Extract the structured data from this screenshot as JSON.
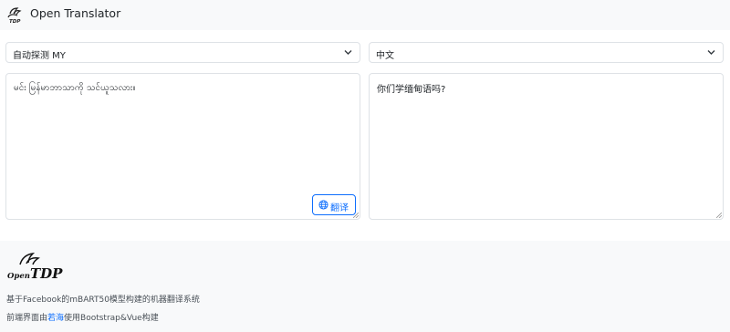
{
  "header": {
    "title": "Open Translator",
    "logo_icon": "tdp-bird-logo-icon"
  },
  "source": {
    "language": "自动探测 MY",
    "text": "မင်း မြန်မာဘာသာကို သင်ယူသလား။"
  },
  "target": {
    "language": "中文",
    "text": "你们学缅甸语吗?"
  },
  "translate_button": {
    "label": "翻译",
    "icon": "globe-icon"
  },
  "footer": {
    "logo_open": "Open",
    "logo_tdp": "TDP",
    "line1": "基于Facebook的mBART50模型构建的机器翻译系统",
    "line2_before": "前端界面由",
    "line2_link": "若海",
    "line2_after": "使用Bootstrap&Vue构建"
  },
  "colors": {
    "accent": "#0d6efd",
    "border": "#dee2e6",
    "bar_background": "#f8f9fa"
  }
}
